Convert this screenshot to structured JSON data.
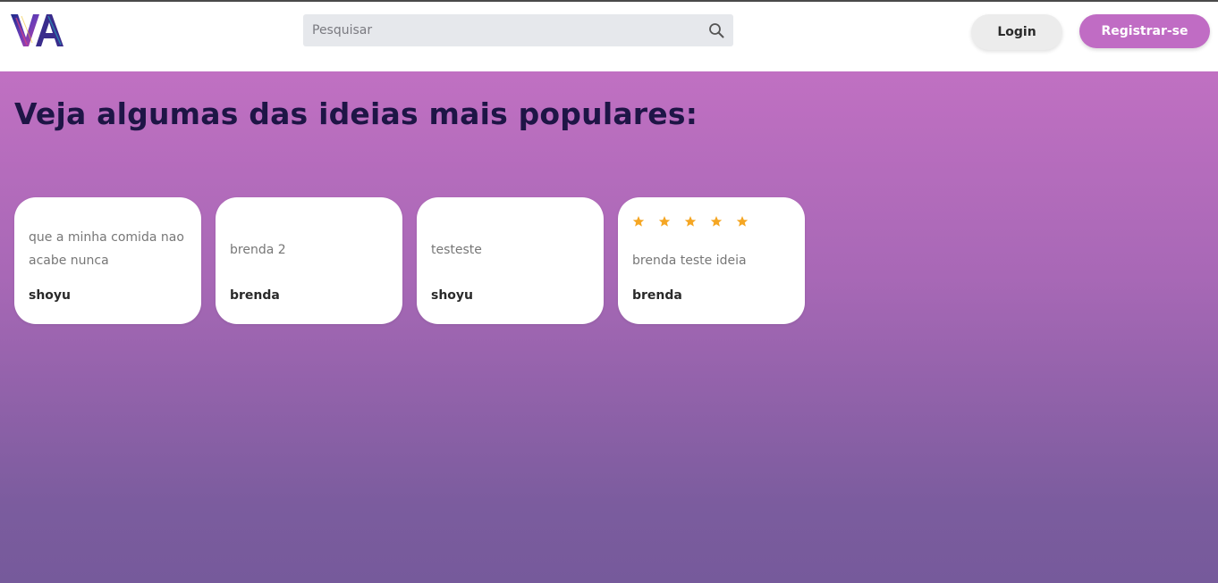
{
  "header": {
    "logo_text": "VA",
    "search": {
      "placeholder": "Pesquisar",
      "value": "",
      "icon": "search-icon"
    },
    "login_label": "Login",
    "register_label": "Registrar-se"
  },
  "colors": {
    "accent": "#c06cc4",
    "title": "#1e1546",
    "star": "#f5a623"
  },
  "main": {
    "title": "Veja algumas das ideias mais populares:",
    "ideas": [
      {
        "text": "que a minha comida nao acabe nunca",
        "author": "shoyu",
        "stars": 0
      },
      {
        "text": "brenda 2",
        "author": "brenda",
        "stars": 0
      },
      {
        "text": "testeste",
        "author": "shoyu",
        "stars": 0
      },
      {
        "text": "brenda teste ideia",
        "author": "brenda",
        "stars": 5
      }
    ]
  }
}
